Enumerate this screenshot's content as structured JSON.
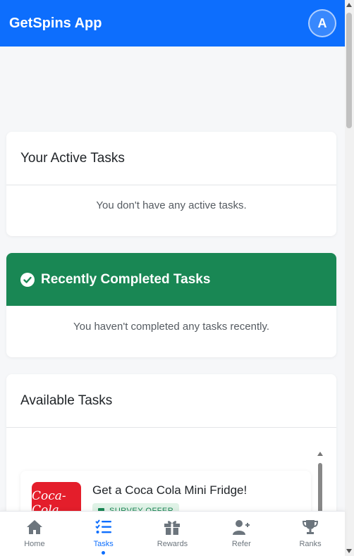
{
  "header": {
    "app_title": "GetSpins App",
    "avatar_letter": "A"
  },
  "active_tasks": {
    "title": "Your Active Tasks",
    "empty_text": "You don't have any active tasks."
  },
  "completed_tasks": {
    "title": "Recently Completed Tasks",
    "empty_text": "You haven't completed any tasks recently."
  },
  "available_tasks": {
    "title": "Available Tasks",
    "items": [
      {
        "title": "Get a Coca Cola Mini Fridge!",
        "badge": "SURVEY OFFER",
        "logo_text": "Coca-Cola"
      }
    ]
  },
  "bottom_nav": {
    "items": [
      {
        "label": "Home",
        "icon": "home-icon"
      },
      {
        "label": "Tasks",
        "icon": "tasks-icon",
        "active": true
      },
      {
        "label": "Rewards",
        "icon": "gift-icon"
      },
      {
        "label": "Refer",
        "icon": "user-plus-icon"
      },
      {
        "label": "Ranks",
        "icon": "trophy-icon"
      }
    ]
  },
  "colors": {
    "primary": "#0d6efd",
    "success": "#198754",
    "coke_red": "#e41e2b"
  }
}
